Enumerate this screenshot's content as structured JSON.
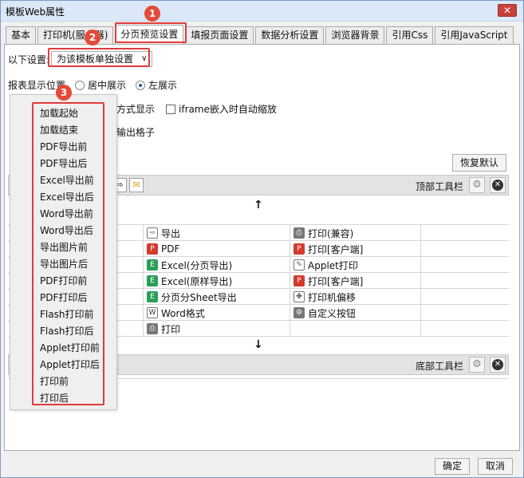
{
  "window": {
    "title": "模板Web属性",
    "close_glyph": "✕"
  },
  "tabs": [
    {
      "label": "基本"
    },
    {
      "label": "打印机(服务器)"
    },
    {
      "label": "分页预览设置"
    },
    {
      "label": "填报页面设置"
    },
    {
      "label": "数据分析设置"
    },
    {
      "label": "浏览器背景"
    },
    {
      "label": "引用Css"
    },
    {
      "label": "引用JavaScript"
    }
  ],
  "settings": {
    "label": "以下设置:",
    "select_value": "为该模板单独设置",
    "position_label": "报表显示位置",
    "position_center": "居中展示",
    "position_left": "左展示",
    "show_mode_tail": "方式显示",
    "iframe_label": "iframe嵌入时自动缩放",
    "output_cell_tail": "输出格子",
    "restore_button": "恢复默认"
  },
  "toolbars": {
    "top_label": "顶部工具栏",
    "bottom_label": "底部工具栏"
  },
  "grid": {
    "rows": [
      [
        "",
        "导出",
        "打印(兼容)",
        ""
      ],
      [
        "",
        "PDF",
        "打印[客户端]",
        ""
      ],
      [
        "",
        "Excel(分页导出)",
        "Applet打印",
        ""
      ],
      [
        "",
        "Excel(原样导出)",
        "打印[客户端]",
        ""
      ],
      [
        "",
        "分页分Sheet导出",
        "打印机偏移",
        ""
      ],
      [
        "",
        "Word格式",
        "自定义按钮",
        ""
      ],
      [
        "",
        "打印",
        "",
        ""
      ]
    ],
    "icons": [
      [
        "",
        "export-icon",
        "printer-icon",
        ""
      ],
      [
        "",
        "pdf-icon",
        "pdf-icon",
        ""
      ],
      [
        "",
        "excel-icon",
        "applet-icon",
        ""
      ],
      [
        "",
        "excel-icon",
        "pdf-icon",
        ""
      ],
      [
        "",
        "excel-icon",
        "move-icon",
        ""
      ],
      [
        "",
        "word-icon",
        "gear-icon",
        ""
      ],
      [
        "",
        "printer-icon",
        "",
        ""
      ]
    ]
  },
  "popup": {
    "items": [
      "加载起始",
      "加载结束",
      "PDF导出前",
      "PDF导出后",
      "Excel导出前",
      "Excel导出后",
      "Word导出前",
      "Word导出后",
      "导出图片前",
      "导出图片后",
      "PDF打印前",
      "PDF打印后",
      "Flash打印前",
      "Flash打印后",
      "Applet打印前",
      "Applet打印后",
      "打印前",
      "打印后"
    ]
  },
  "annotations": {
    "badge1": "1",
    "badge2": "2",
    "badge3": "3"
  },
  "footer": {
    "ok": "确定",
    "cancel": "取消"
  },
  "colors": {
    "accent_red": "#e03b3b",
    "title_bar": "#dbe8f8"
  }
}
